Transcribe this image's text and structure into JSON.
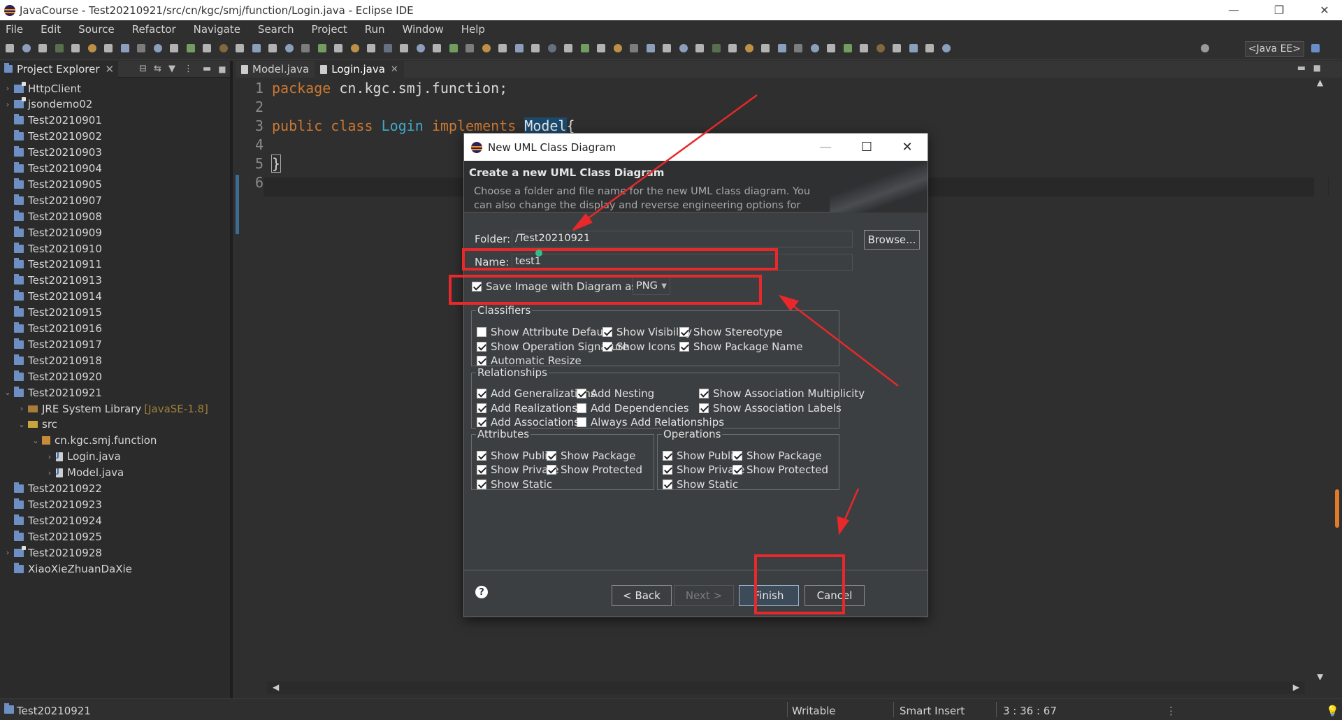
{
  "window": {
    "title": "JavaCourse - Test20210921/src/cn/kgc/smj/function/Login.java - Eclipse IDE"
  },
  "menu": [
    "File",
    "Edit",
    "Source",
    "Refactor",
    "Navigate",
    "Search",
    "Project",
    "Run",
    "Window",
    "Help"
  ],
  "toolbar": {
    "perspective": "<Java EE>"
  },
  "explorer": {
    "tab_label": "Project Explorer",
    "items": [
      {
        "label": "HttpClient",
        "icon": "git-project-icon",
        "chevron": "›",
        "indent": 0
      },
      {
        "label": "jsondemo02",
        "icon": "git-project-icon",
        "chevron": "›",
        "indent": 0
      },
      {
        "label": "Test20210901",
        "icon": "folder-icon",
        "chevron": "",
        "indent": 0
      },
      {
        "label": "Test20210902",
        "icon": "folder-icon",
        "chevron": "",
        "indent": 0
      },
      {
        "label": "Test20210903",
        "icon": "folder-icon",
        "chevron": "",
        "indent": 0
      },
      {
        "label": "Test20210904",
        "icon": "folder-icon",
        "chevron": "",
        "indent": 0
      },
      {
        "label": "Test20210905",
        "icon": "folder-icon",
        "chevron": "",
        "indent": 0
      },
      {
        "label": "Test20210907",
        "icon": "folder-icon",
        "chevron": "",
        "indent": 0
      },
      {
        "label": "Test20210908",
        "icon": "folder-icon",
        "chevron": "",
        "indent": 0
      },
      {
        "label": "Test20210909",
        "icon": "folder-icon",
        "chevron": "",
        "indent": 0
      },
      {
        "label": "Test20210910",
        "icon": "folder-icon",
        "chevron": "",
        "indent": 0
      },
      {
        "label": "Test20210911",
        "icon": "folder-icon",
        "chevron": "",
        "indent": 0
      },
      {
        "label": "Test20210913",
        "icon": "folder-icon",
        "chevron": "",
        "indent": 0
      },
      {
        "label": "Test20210914",
        "icon": "folder-icon",
        "chevron": "",
        "indent": 0
      },
      {
        "label": "Test20210915",
        "icon": "folder-icon",
        "chevron": "",
        "indent": 0
      },
      {
        "label": "Test20210916",
        "icon": "folder-icon",
        "chevron": "",
        "indent": 0
      },
      {
        "label": "Test20210917",
        "icon": "folder-icon",
        "chevron": "",
        "indent": 0
      },
      {
        "label": "Test20210918",
        "icon": "folder-icon",
        "chevron": "",
        "indent": 0
      },
      {
        "label": "Test20210920",
        "icon": "folder-icon",
        "chevron": "",
        "indent": 0
      },
      {
        "label": "Test20210921",
        "icon": "open-project-icon",
        "chevron": "⌄",
        "indent": 0
      },
      {
        "label": "JRE System Library",
        "suffix": "[JavaSE-1.8]",
        "icon": "library-icon",
        "chevron": "›",
        "indent": 1
      },
      {
        "label": "src",
        "icon": "source-folder-icon",
        "chevron": "⌄",
        "indent": 1
      },
      {
        "label": "cn.kgc.smj.function",
        "icon": "package-icon",
        "chevron": "⌄",
        "indent": 2
      },
      {
        "label": "Login.java",
        "icon": "java-file-icon",
        "chevron": "›",
        "indent": 3
      },
      {
        "label": "Model.java",
        "icon": "java-file-icon",
        "chevron": "›",
        "indent": 3
      },
      {
        "label": "Test20210922",
        "icon": "folder-icon",
        "chevron": "",
        "indent": 0
      },
      {
        "label": "Test20210923",
        "icon": "folder-icon",
        "chevron": "",
        "indent": 0
      },
      {
        "label": "Test20210924",
        "icon": "folder-icon",
        "chevron": "",
        "indent": 0
      },
      {
        "label": "Test20210925",
        "icon": "folder-icon",
        "chevron": "",
        "indent": 0
      },
      {
        "label": "Test20210928",
        "icon": "git-project-icon",
        "chevron": "›",
        "indent": 0
      },
      {
        "label": "XiaoXieZhuanDaXie",
        "icon": "folder-icon",
        "chevron": "",
        "indent": 0
      }
    ]
  },
  "editor": {
    "tabs": [
      {
        "label": "Model.java",
        "active": false
      },
      {
        "label": "Login.java",
        "active": true
      }
    ],
    "line_numbers": [
      "1",
      "2",
      "3",
      "4",
      "5",
      "6"
    ],
    "code": {
      "l1_kw": "package",
      "l1_rest": " cn.kgc.smj.function;",
      "l3_kw1": "public",
      "l3_kw2": "class",
      "l3_name": "Login",
      "l3_kw3": "implements",
      "l3_iface": "Model",
      "l3_brace": "{",
      "l5": "}"
    }
  },
  "dialog": {
    "title": "New UML Class Diagram",
    "header": "Create a new UML Class Diagram",
    "description": "Choose a folder and file name for the new UML class diagram. You can also change the display and reverse engineering options for",
    "folder_label": "Folder:",
    "folder_value": "/Test20210921",
    "browse": "Browse...",
    "name_label": "Name:",
    "name_value": "test1",
    "save_image_label": "Save Image with Diagram as",
    "image_format": "PNG",
    "groups": {
      "classifiers": {
        "title": "Classifiers",
        "items": [
          {
            "label": "Show Attribute Default",
            "checked": false
          },
          {
            "label": "Show Visibility",
            "checked": true
          },
          {
            "label": "Show Stereotype",
            "checked": true
          },
          {
            "label": "Show Operation Signature",
            "checked": true
          },
          {
            "label": "Show Icons",
            "checked": true
          },
          {
            "label": "Show Package Name",
            "checked": true
          },
          {
            "label": "Automatic Resize",
            "checked": true
          }
        ]
      },
      "relationships": {
        "title": "Relationships",
        "items": [
          {
            "label": "Add Generalizations",
            "checked": true
          },
          {
            "label": "Add Nesting",
            "checked": true
          },
          {
            "label": "Show Association Multiplicity",
            "checked": true
          },
          {
            "label": "Add Realizations",
            "checked": true
          },
          {
            "label": "Add Dependencies",
            "checked": false
          },
          {
            "label": "Show Association Labels",
            "checked": true
          },
          {
            "label": "Add Associations",
            "checked": true
          },
          {
            "label": "Always Add Relationships",
            "checked": false
          }
        ]
      },
      "attributes": {
        "title": "Attributes",
        "items": [
          {
            "label": "Show Public",
            "checked": true
          },
          {
            "label": "Show Package",
            "checked": true
          },
          {
            "label": "Show Private",
            "checked": true
          },
          {
            "label": "Show Protected",
            "checked": true
          },
          {
            "label": "Show Static",
            "checked": true
          }
        ]
      },
      "operations": {
        "title": "Operations",
        "items": [
          {
            "label": "Show Public",
            "checked": true
          },
          {
            "label": "Show Package",
            "checked": true
          },
          {
            "label": "Show Private",
            "checked": true
          },
          {
            "label": "Show Protected",
            "checked": true
          },
          {
            "label": "Show Static",
            "checked": true
          }
        ]
      }
    },
    "buttons": {
      "back": "< Back",
      "next": "Next >",
      "finish": "Finish",
      "cancel": "Cancel"
    }
  },
  "status": {
    "project": "Test20210921",
    "writable": "Writable",
    "insert_mode": "Smart Insert",
    "position": "3 : 36 : 67"
  },
  "colors": {
    "annotation_red": "#e8282a",
    "keyword": "#cc7832",
    "class_name": "#3fa9c9"
  }
}
